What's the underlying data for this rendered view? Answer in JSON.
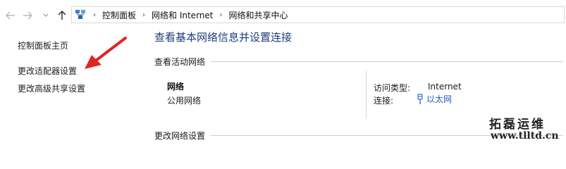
{
  "nav": {
    "back_icon": "back-arrow-icon",
    "forward_icon": "forward-arrow-icon",
    "recent_icon": "chevron-down-icon",
    "up_icon": "up-arrow-icon"
  },
  "breadcrumb": {
    "root_icon": "network-sharing-center-icon",
    "items": [
      "控制面板",
      "网络和 Internet",
      "网络和共享中心"
    ]
  },
  "sidebar": {
    "items": [
      {
        "label": "控制面板主页"
      },
      {
        "label": "更改适配器设置"
      },
      {
        "label": "更改高级共享设置"
      }
    ]
  },
  "annotation": {
    "arrow_color": "#e02424"
  },
  "main": {
    "title": "查看基本网络信息并设置连接",
    "active_section": "查看活动网络",
    "network": {
      "name": "网络",
      "type": "公用网络",
      "access_label": "访问类型:",
      "access_value": "Internet",
      "connection_label": "连接:",
      "connection_icon": "ethernet-icon",
      "connection_value": "以太网"
    },
    "change_section": "更改网络设置"
  },
  "watermark": {
    "line1": "拓磊运维",
    "line2": "www.tlltd.cn"
  },
  "colors": {
    "title": "#1c3d7d",
    "link": "#1f5fbf",
    "divider": "#cfcfcf"
  }
}
